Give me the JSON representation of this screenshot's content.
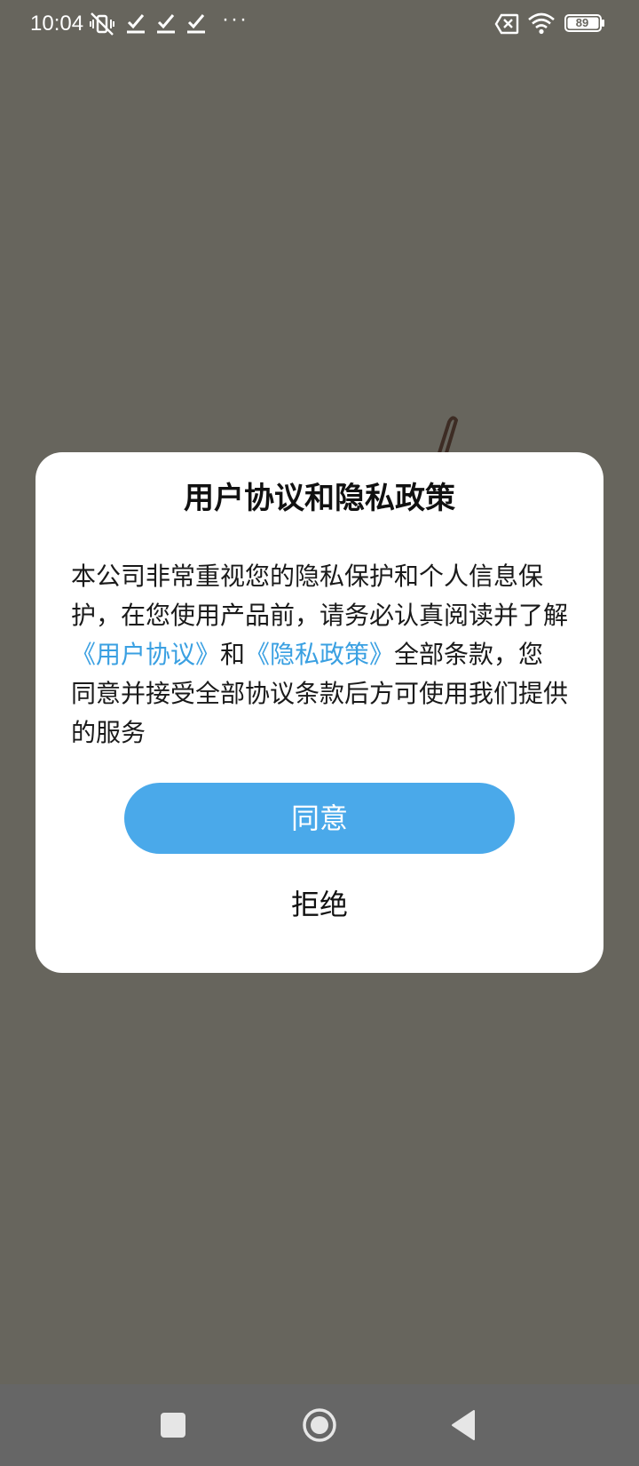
{
  "status_bar": {
    "time": "10:04",
    "ellipsis": "···",
    "battery": "89"
  },
  "dialog": {
    "title": "用户协议和隐私政策",
    "body_part1": "本公司非常重视您的隐私保护和个人信息保护，在您使用产品前，请务必认真阅读并了解",
    "link_user_agreement": "《用户协议》",
    "body_and": "和",
    "link_privacy_policy": "《隐私政策》",
    "body_part2": "全部条款，您同意并接受全部协议条款后方可使用我们提供的服务",
    "agree_label": "同意",
    "reject_label": "拒绝"
  },
  "icons": {
    "status": [
      "vibrate-off-icon",
      "check-icon",
      "check-icon",
      "check-icon",
      "sim-off-icon",
      "wifi-icon",
      "battery-icon"
    ],
    "nav": [
      "recent-apps-icon",
      "home-icon",
      "back-icon"
    ]
  },
  "colors": {
    "background": "#67655d",
    "dialog": "#ffffff",
    "accent": "#4aa9ea",
    "link": "#3aa0e2",
    "nav_bar": "#666666"
  }
}
